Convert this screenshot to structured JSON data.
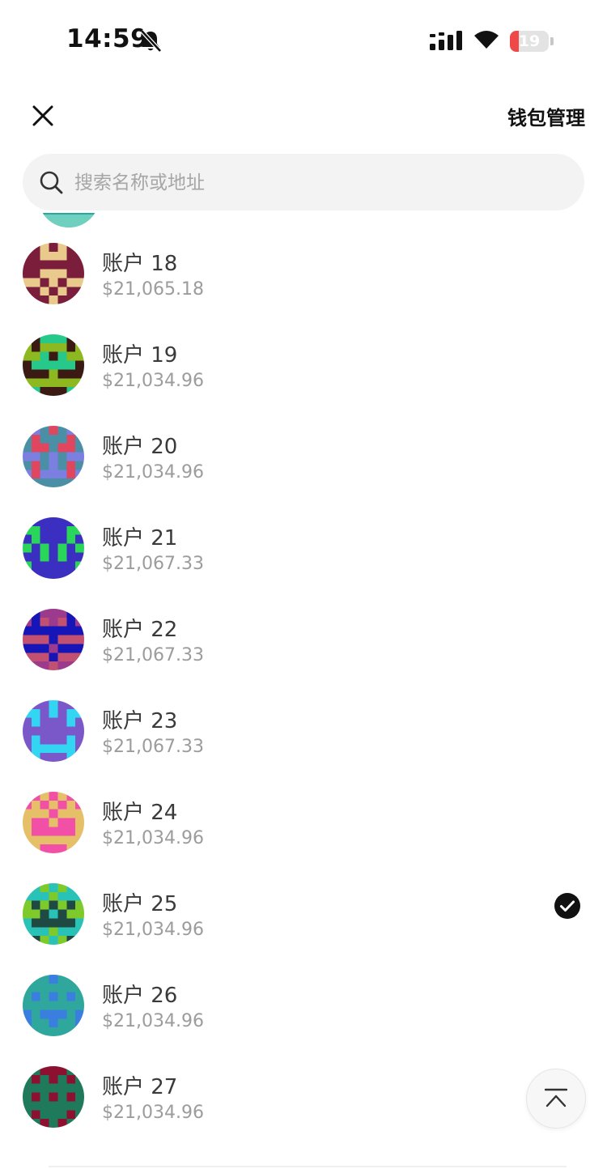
{
  "status": {
    "time": "14:59",
    "battery": "19",
    "icons": [
      "bell-muted-icon",
      "signal-icon",
      "wifi-icon",
      "battery-icon"
    ]
  },
  "header": {
    "close_icon": "close-icon",
    "manage_label": "钱包管理"
  },
  "search": {
    "placeholder": "搜索名称或地址",
    "icon": "search-icon"
  },
  "accounts": [
    {
      "name": "账户 18",
      "balance": "$21,065.18",
      "selected": false,
      "colors": [
        "#7b1e3c",
        "#e9c98c"
      ]
    },
    {
      "name": "账户 19",
      "balance": "$21,034.96",
      "selected": false,
      "colors": [
        "#8db81f",
        "#3a1a12",
        "#27c98a"
      ]
    },
    {
      "name": "账户 20",
      "balance": "$21,034.96",
      "selected": false,
      "colors": [
        "#4b8fa6",
        "#7a7fe0",
        "#e0465e"
      ]
    },
    {
      "name": "账户 21",
      "balance": "$21,067.33",
      "selected": false,
      "colors": [
        "#3a2fc0",
        "#2ad65a"
      ]
    },
    {
      "name": "账户 22",
      "balance": "$21,067.33",
      "selected": false,
      "colors": [
        "#1515b8",
        "#9c3a8e",
        "#c25070"
      ]
    },
    {
      "name": "账户 23",
      "balance": "$21,067.33",
      "selected": false,
      "colors": [
        "#7a58c9",
        "#33d6f2"
      ]
    },
    {
      "name": "账户 24",
      "balance": "$21,034.96",
      "selected": false,
      "colors": [
        "#e6c069",
        "#f24fa6"
      ]
    },
    {
      "name": "账户 25",
      "balance": "$21,034.96",
      "selected": true,
      "colors": [
        "#7dca2a",
        "#29c2b6",
        "#1f4a44"
      ]
    },
    {
      "name": "账户 26",
      "balance": "$21,034.96",
      "selected": false,
      "colors": [
        "#2fa79d",
        "#3a7ee0"
      ]
    },
    {
      "name": "账户 27",
      "balance": "$21,034.96",
      "selected": false,
      "colors": [
        "#1f7a5c",
        "#8e1030"
      ]
    }
  ],
  "selected_icon": "check-circle-icon",
  "scroll_top_icon": "scroll-to-top-icon"
}
